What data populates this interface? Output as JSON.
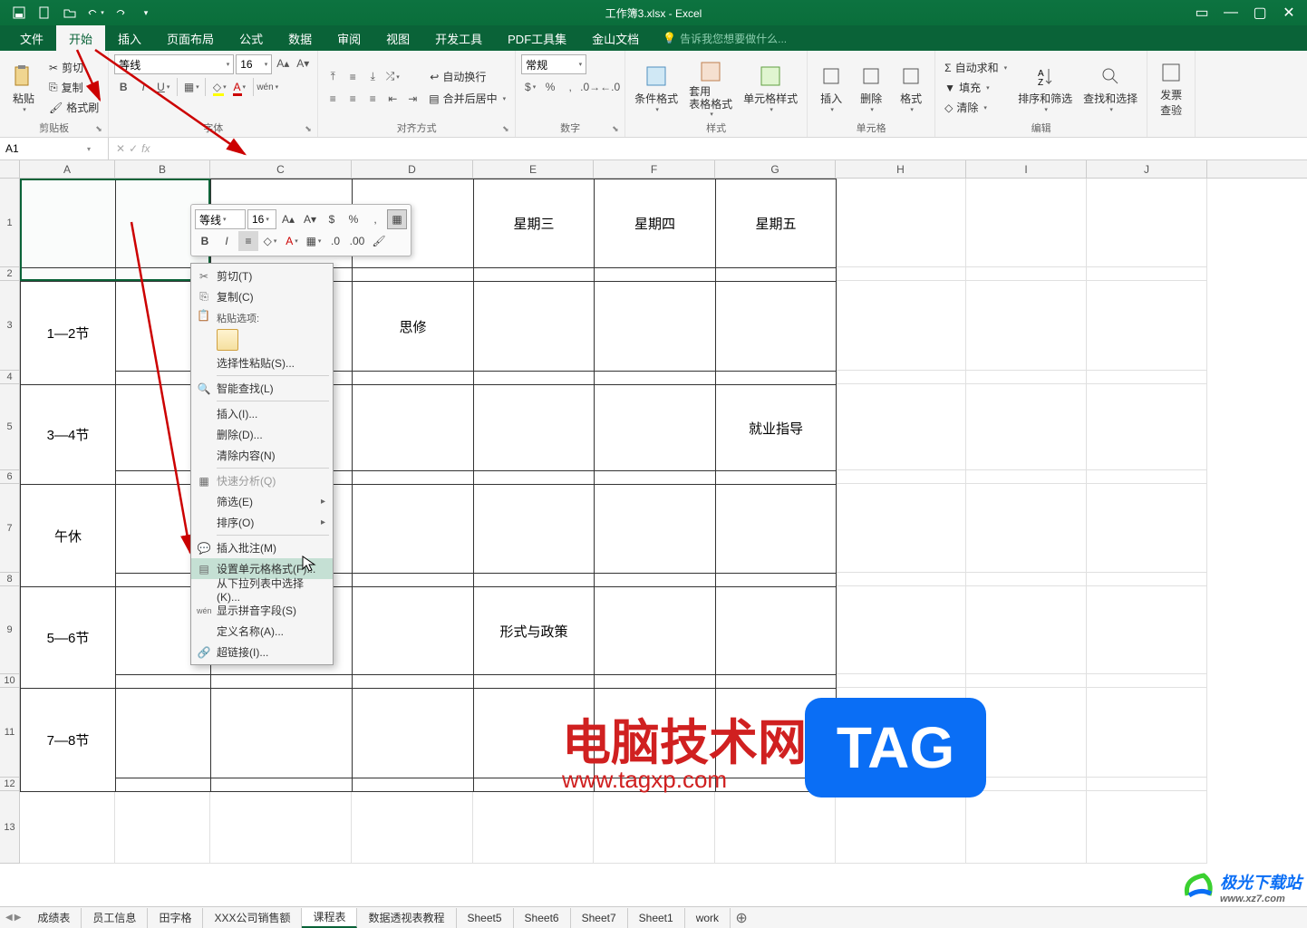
{
  "app": {
    "title": "工作簿3.xlsx - Excel"
  },
  "qat": {
    "save": "save",
    "new": "new",
    "open": "open",
    "undo": "undo",
    "redo": "redo"
  },
  "ribbon_tabs": [
    "文件",
    "开始",
    "插入",
    "页面布局",
    "公式",
    "数据",
    "审阅",
    "视图",
    "开发工具",
    "PDF工具集",
    "金山文档"
  ],
  "tell_me": "告诉我您想要做什么...",
  "ribbon": {
    "clipboard": {
      "paste": "粘贴",
      "cut": "剪切",
      "copy": "复制",
      "format_painter": "格式刷",
      "group": "剪贴板"
    },
    "font": {
      "name": "等线",
      "size": "16",
      "group": "字体"
    },
    "alignment": {
      "wrap": "自动换行",
      "merge": "合并后居中",
      "group": "对齐方式"
    },
    "number": {
      "format": "常规",
      "group": "数字"
    },
    "styles": {
      "cond": "条件格式",
      "table": "套用\n表格格式",
      "cell_style": "单元格样式",
      "group": "样式"
    },
    "cells": {
      "insert": "插入",
      "delete": "删除",
      "format": "格式",
      "group": "单元格"
    },
    "editing": {
      "sum": "自动求和",
      "fill": "填充",
      "clear": "清除",
      "sort": "排序和筛选",
      "find": "查找和选择",
      "group": "编辑"
    },
    "invoice": {
      "label": "发票\n查验"
    }
  },
  "formula": {
    "cell_ref": "A1",
    "value": ""
  },
  "columns": {
    "letters": [
      "A",
      "B",
      "C",
      "D",
      "E",
      "F",
      "G",
      "H",
      "I",
      "J"
    ],
    "widths": [
      105,
      105,
      156,
      134,
      133,
      134,
      133,
      144,
      133,
      133
    ]
  },
  "rows": {
    "heights": [
      98,
      15,
      99,
      15,
      95,
      15,
      98,
      15,
      97,
      15,
      99,
      15,
      80
    ],
    "count": 13
  },
  "cells": {
    "E1": "星期三",
    "F1": "星期四",
    "G1": "星期五",
    "A3": "1—2节",
    "D3": "思修",
    "A5": "3—4节",
    "G5": "就业指导",
    "A7": "午休",
    "A9": "5—6节",
    "E9": "形式与政策",
    "A11": "7—8节"
  },
  "mini_toolbar": {
    "font": "等线",
    "size": "16"
  },
  "context_menu": {
    "cut": "剪切(T)",
    "copy": "复制(C)",
    "paste_opts": "粘贴选项:",
    "paste_special": "选择性粘贴(S)...",
    "smart_find": "智能查找(L)",
    "insert": "插入(I)...",
    "delete": "删除(D)...",
    "clear": "清除内容(N)",
    "quick_analysis": "快速分析(Q)",
    "filter": "筛选(E)",
    "sort": "排序(O)",
    "insert_comment": "插入批注(M)",
    "format_cells": "设置单元格格式(F)...",
    "pick_list": "从下拉列表中选择(K)...",
    "show_pinyin": "显示拼音字段(S)",
    "define_name": "定义名称(A)...",
    "hyperlink": "超链接(I)..."
  },
  "sheets": [
    "成绩表",
    "员工信息",
    "田字格",
    "XXX公司销售额",
    "课程表",
    "数据透视表教程",
    "Sheet5",
    "Sheet6",
    "Sheet7",
    "Sheet1",
    "work"
  ],
  "active_sheet": 4,
  "watermark": {
    "brand": "电脑技术网",
    "url": "www.tagxp.com",
    "tag": "TAG",
    "jg": "极光下载站",
    "jg_url": "www.xz7.com"
  }
}
